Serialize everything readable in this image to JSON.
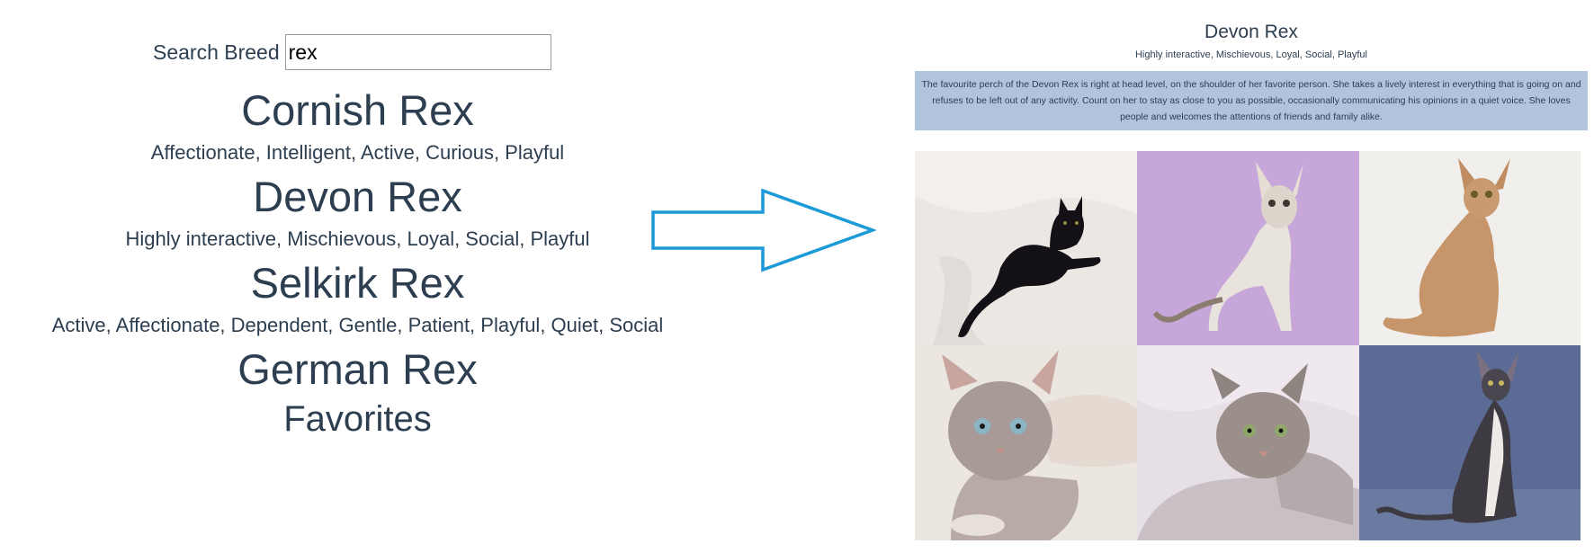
{
  "search": {
    "label": "Search Breed",
    "value": "rex"
  },
  "breeds": [
    {
      "name": "Cornish Rex",
      "temperament": "Affectionate, Intelligent, Active, Curious, Playful"
    },
    {
      "name": "Devon Rex",
      "temperament": "Highly interactive, Mischievous, Loyal, Social, Playful"
    },
    {
      "name": "Selkirk Rex",
      "temperament": "Active, Affectionate, Dependent, Gentle, Patient, Playful, Quiet, Social"
    },
    {
      "name": "German Rex",
      "temperament": ""
    }
  ],
  "favorites_label": "Favorites",
  "arrow": {
    "color": "#1a9ad6",
    "icon": "right-arrow-icon"
  },
  "detail": {
    "name": "Devon Rex",
    "temperament": "Highly interactive, Mischievous, Loyal, Social, Playful",
    "description": "The favourite perch of the Devon Rex is right at head level, on the shoulder of her favorite person. She takes a lively interest in everything that is going on and refuses to be left out of any activity. Count on her to stay as close to you as possible, occasionally communicating his opinions in a quiet voice. She loves people and welcomes the attentions of friends and family alike.",
    "desc_bg": "#b0c4de",
    "photos": [
      {
        "label": "black-cat-photo",
        "bg": "#ece9e5"
      },
      {
        "label": "white-cat-on-purple-photo",
        "bg": "#c8a8dc"
      },
      {
        "label": "tan-cat-photo",
        "bg": "#f0eeeb"
      },
      {
        "label": "grey-kitten-closeup-photo",
        "bg": "#ece7e2"
      },
      {
        "label": "tabby-cat-lying-photo",
        "bg": "#e4dfe8"
      },
      {
        "label": "bicolor-cat-on-blue-photo",
        "bg": "#5a6a94"
      }
    ]
  }
}
